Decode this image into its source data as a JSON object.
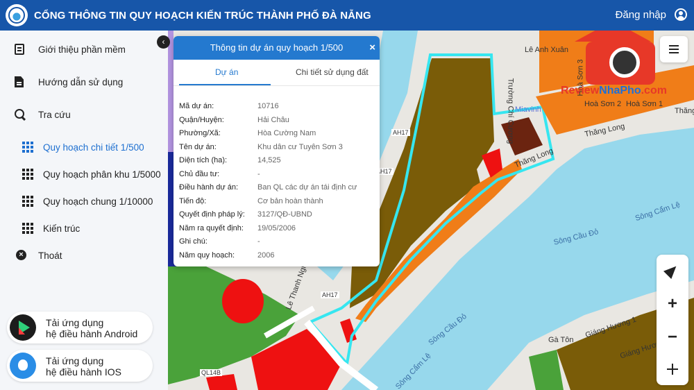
{
  "header": {
    "title": "CỔNG THÔNG TIN QUY HOẠCH KIẾN TRÚC THÀNH PHỐ ĐÀ NẴNG",
    "login_label": "Đăng nhập"
  },
  "sidebar": {
    "items": [
      {
        "label": "Giới thiệu phần mềm",
        "icon": "book-icon"
      },
      {
        "label": "Hướng dẫn sử dụng",
        "icon": "document-icon"
      },
      {
        "label": "Tra cứu",
        "icon": "search-icon"
      },
      {
        "label": "Quy hoạch chi tiết 1/500",
        "icon": "grid-icon",
        "active": true
      },
      {
        "label": "Quy hoạch phân khu 1/5000",
        "icon": "grid-icon"
      },
      {
        "label": "Quy hoạch chung 1/10000",
        "icon": "grid-icon"
      },
      {
        "label": "Kiến trúc",
        "icon": "grid-icon"
      },
      {
        "label": "Thoát",
        "icon": "close-circle-icon"
      }
    ],
    "downloads": {
      "android": {
        "line1": "Tải ứng dụng",
        "line2": "hệ điều hành Android"
      },
      "ios": {
        "line1": "Tải ứng dụng",
        "line2": "hệ điều hành IOS"
      }
    }
  },
  "panel": {
    "title": "Thông tin dự án quy hoạch 1/500",
    "close_label": "×",
    "tabs": [
      "Dự án",
      "Chi tiết sử dụng đất"
    ],
    "active_tab": 0,
    "fields": [
      {
        "key": "Mã dự án:",
        "value": "10716"
      },
      {
        "key": "Quận/Huyện:",
        "value": "Hải Châu"
      },
      {
        "key": "Phường/Xã:",
        "value": "Hòa Cường Nam"
      },
      {
        "key": "Tên dự án:",
        "value": "Khu dân cư Tuyên Sơn 3"
      },
      {
        "key": "Diện tích (ha):",
        "value": "14,525"
      },
      {
        "key": "Chủ đầu tư:",
        "value": "-"
      },
      {
        "key": "Điều hành dự án:",
        "value": "Ban QL các dự án tái định cư"
      },
      {
        "key": "Tiến độ:",
        "value": "Cơ bản hoàn thành"
      },
      {
        "key": "Quyết định pháp lý:",
        "value": "3127/QĐ-UBND"
      },
      {
        "key": "Năm ra quyết định:",
        "value": "19/05/2006"
      },
      {
        "key": "Ghi chú:",
        "value": "-"
      },
      {
        "key": "Năm quy hoạch:",
        "value": "2006"
      }
    ]
  },
  "map": {
    "labels": {
      "song_cam_le_1": "Sông Cẩm Lệ",
      "song_cau_do_1": "Sông Cầu Đỏ",
      "song_cau_do_2": "Sông Cầu Đỏ",
      "song_cam_le_2": "Sông Cẩm Lệ",
      "thang_long_1": "Thăng Long",
      "thang_long_2": "Thăng Long",
      "thang_long_3": "Thăng",
      "le_anh_xuan": "Lê Anh Xuân",
      "hoa_son_1": "Hoà Sơn 3",
      "hoa_son_2": "Hoà Sơn 2",
      "hoa_son_3": "Hoà Sơn 1",
      "le_thanh_nghi": "Lê Thanh Nghị",
      "truong_chi_cuong": "Trường Chí Cương",
      "mia_vinh": "Miavinh",
      "ah17_1": "AH17",
      "ah17_2": "AH17",
      "ah17_3": "AH17",
      "ql14b": "QL14B",
      "giang_huong_1": "Giáng Hương 1",
      "giang_huong_2": "Giáng Hương 2",
      "ga_ton": "Gà Tôn"
    },
    "watermark": {
      "part1": "Review",
      "part2": "NhaPho",
      "part3": ".com"
    },
    "colors": {
      "water": "#97d8ec",
      "outline": "#36e6f0",
      "brown": "#7a5c08",
      "orange": "#f07d18",
      "red": "#ee1111",
      "green": "#4aa23a",
      "navy": "#1a2a9c",
      "accent": "#2479cf"
    }
  },
  "controls": {
    "zoom_in": "+",
    "zoom_out": "−"
  }
}
